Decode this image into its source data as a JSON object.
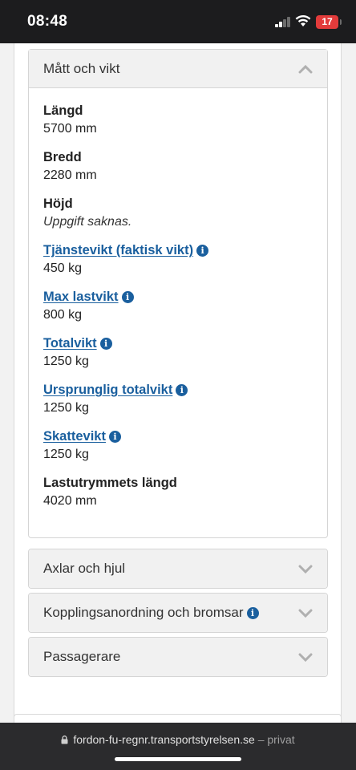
{
  "status_bar": {
    "time": "08:48",
    "battery": "17"
  },
  "sections": {
    "matt_och_vikt": {
      "title": "Mått och vikt",
      "fields": [
        {
          "label": "Längd",
          "value": "5700 mm",
          "link": false
        },
        {
          "label": "Bredd",
          "value": "2280 mm",
          "link": false
        },
        {
          "label": "Höjd",
          "value": "Uppgift saknas.",
          "link": false
        },
        {
          "label": "Tjänstevikt (faktisk vikt)",
          "value": "450 kg",
          "link": true
        },
        {
          "label": "Max lastvikt",
          "value": "800 kg",
          "link": true
        },
        {
          "label": "Totalvikt",
          "value": "1250 kg",
          "link": true
        },
        {
          "label": "Ursprunglig totalvikt",
          "value": "1250 kg",
          "link": true
        },
        {
          "label": "Skattevikt",
          "value": "1250 kg",
          "link": true
        },
        {
          "label": "Lastutrymmets längd",
          "value": "4020 mm",
          "link": false
        }
      ]
    },
    "axlar_och_hjul": {
      "title": "Axlar och hjul"
    },
    "kopplingsanordning": {
      "title": "Kopplingsanordning och bromsar"
    },
    "passagerare": {
      "title": "Passagerare"
    }
  },
  "browser": {
    "url": "fordon-fu-regnr.transportstyrelsen.se",
    "separator": "–",
    "mode": "privat"
  },
  "colors": {
    "link": "#1a5f9e",
    "battery": "#e23b3b"
  }
}
